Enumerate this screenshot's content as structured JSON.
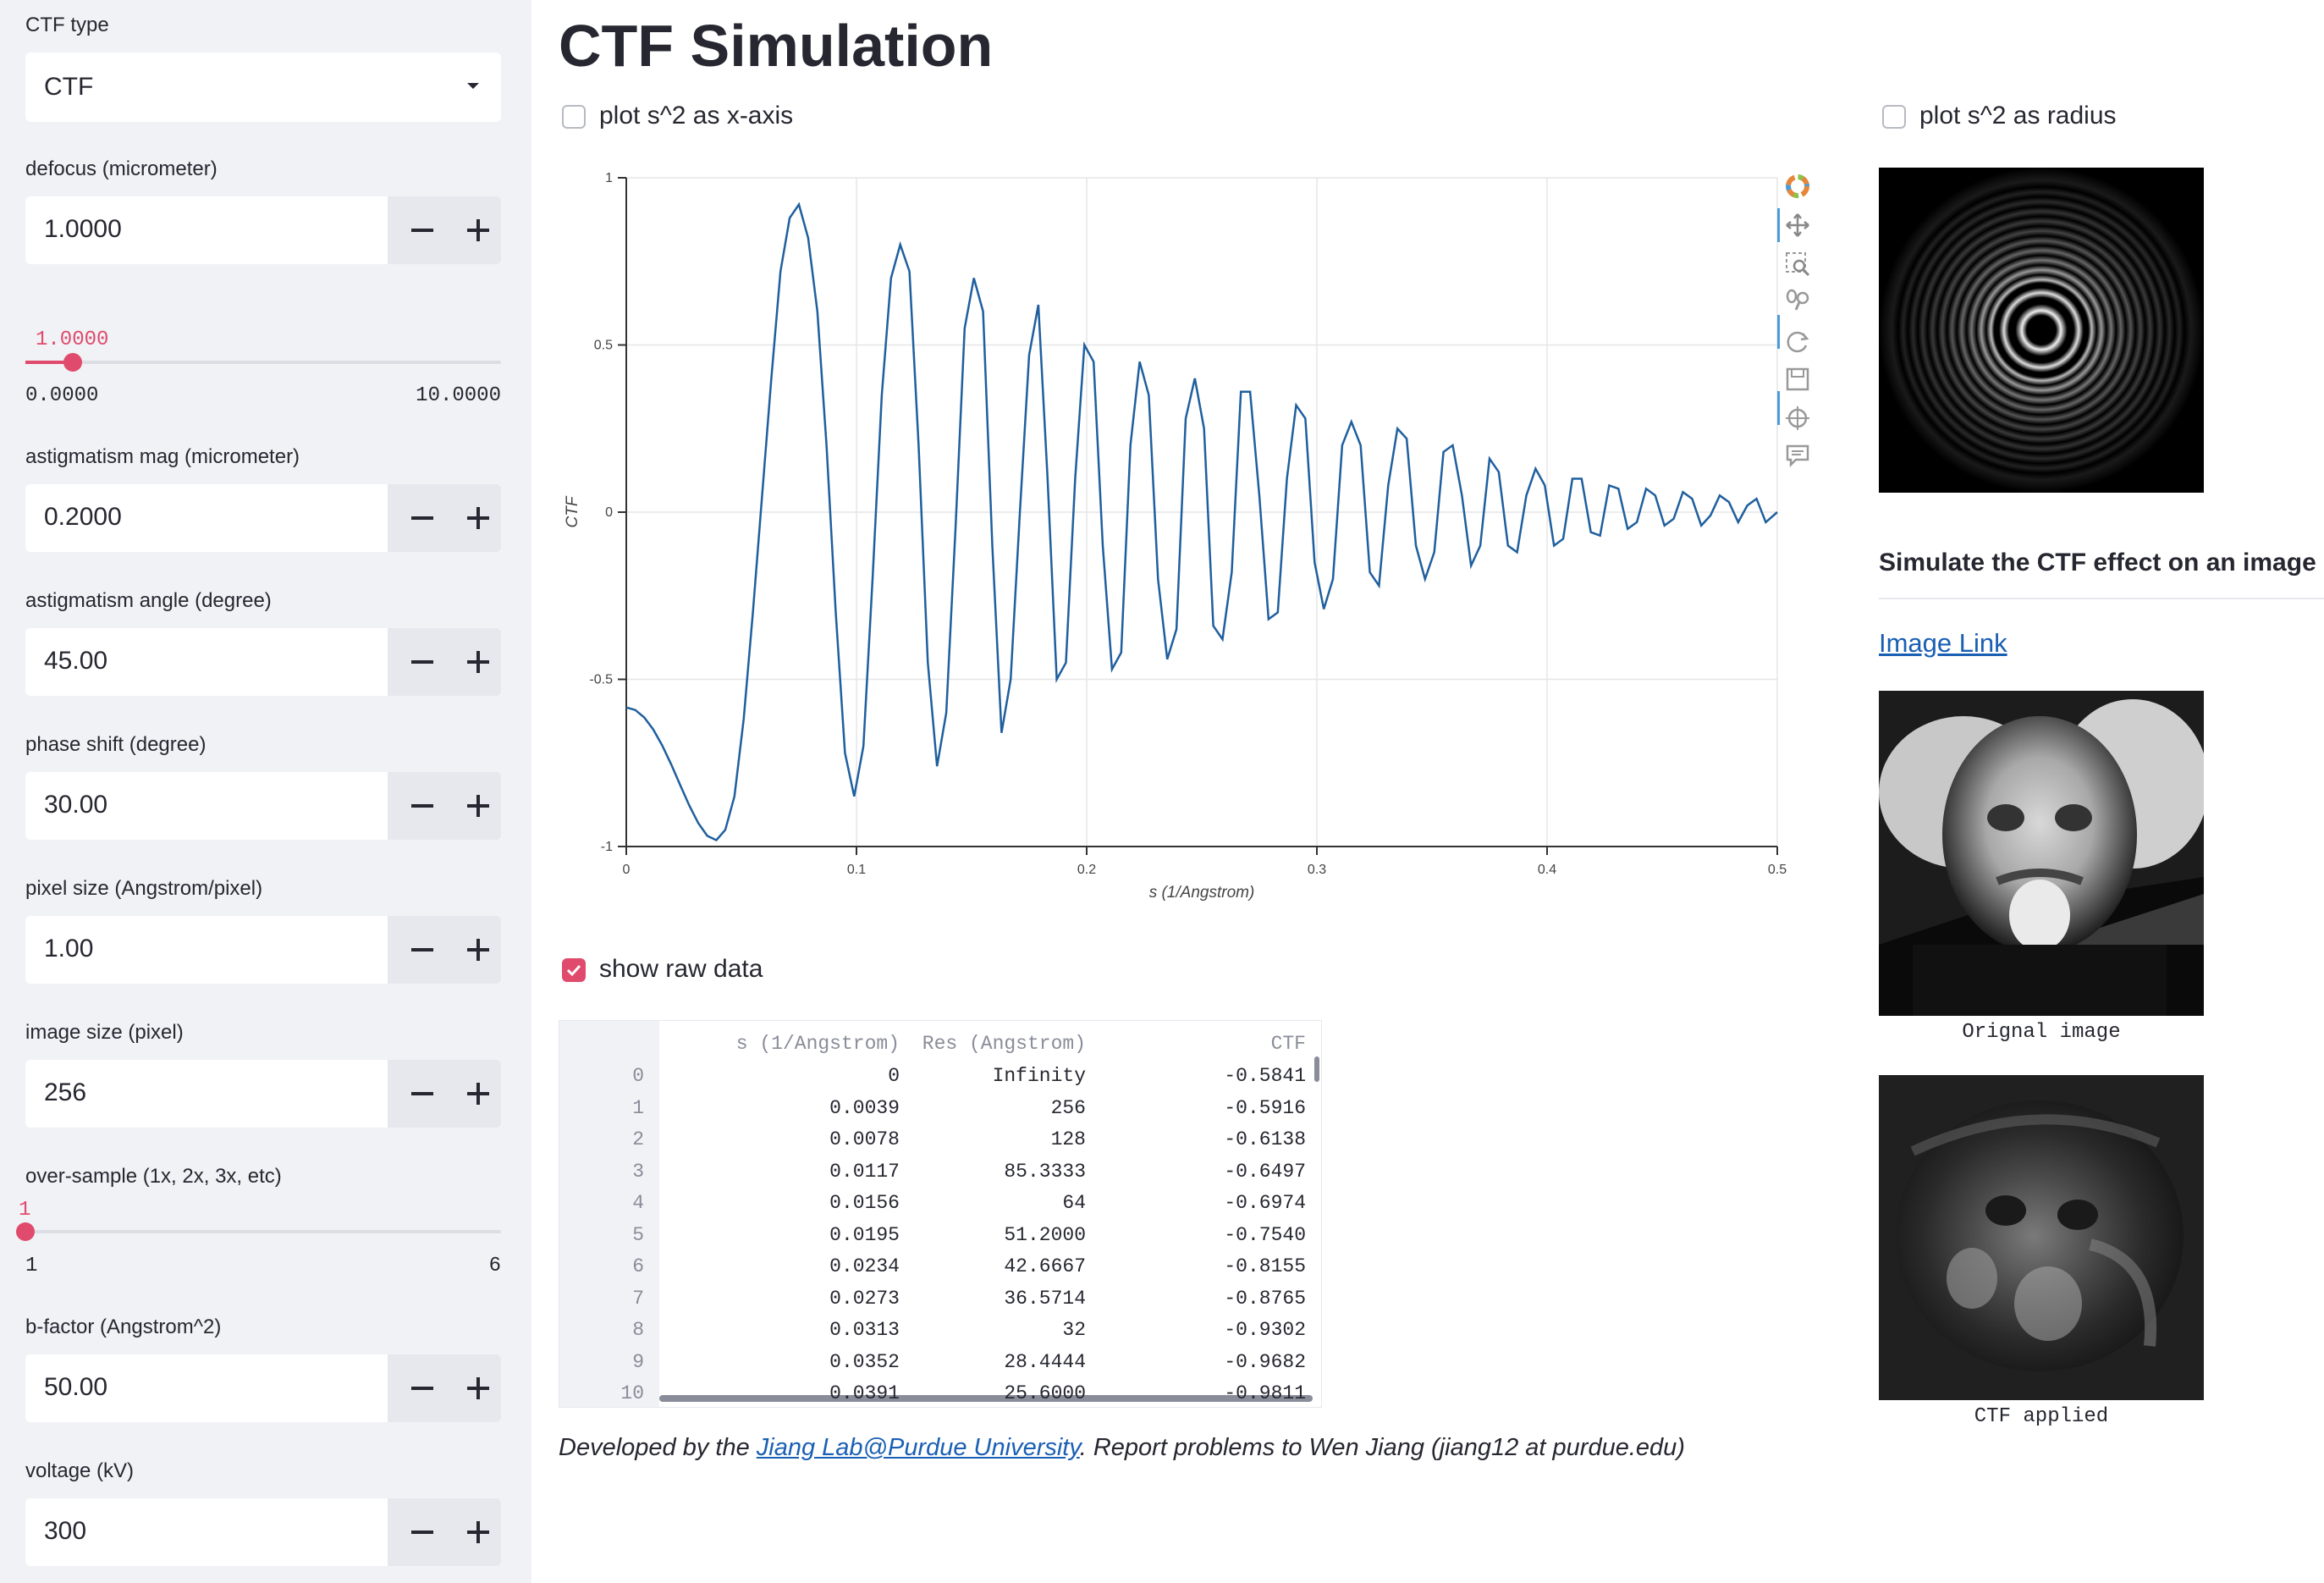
{
  "sidebar": {
    "ctf_type": {
      "label": "CTF type",
      "value": "CTF"
    },
    "defocus": {
      "label": "defocus (micrometer)",
      "value": "1.0000",
      "slider_value": "1.0000",
      "slider_min": "0.0000",
      "slider_max": "10.0000",
      "slider_fraction": 0.1
    },
    "astig_mag": {
      "label": "astigmatism mag (micrometer)",
      "value": "0.2000"
    },
    "astig_angle": {
      "label": "astigmatism angle (degree)",
      "value": "45.00"
    },
    "phase_shift": {
      "label": "phase shift (degree)",
      "value": "30.00"
    },
    "pixel_size": {
      "label": "pixel size (Angstrom/pixel)",
      "value": "1.00"
    },
    "image_size": {
      "label": "image size (pixel)",
      "value": "256"
    },
    "oversample": {
      "label": "over-sample (1x, 2x, 3x, etc)",
      "slider_value": "1",
      "slider_min": "1",
      "slider_max": "6",
      "slider_fraction": 0
    },
    "bfactor": {
      "label": "b-factor (Angstrom^2)",
      "value": "50.00"
    },
    "voltage": {
      "label": "voltage (kV)",
      "value": "300"
    }
  },
  "main": {
    "title": "CTF Simulation",
    "plot_s2_xaxis": {
      "label": "plot s^2 as x-axis",
      "checked": false
    },
    "show_raw": {
      "label": "show raw data",
      "checked": true
    },
    "footer": {
      "prefix": "Developed by the ",
      "link": "Jiang Lab@Purdue University",
      "suffix": ". Report problems to Wen Jiang (jiang12 at purdue.edu)"
    }
  },
  "chart_data": {
    "type": "line",
    "xlabel": "s (1/Angstrom)",
    "ylabel": "CTF",
    "xlim": [
      0,
      0.5
    ],
    "ylim": [
      -1,
      1
    ],
    "xticks": [
      "0",
      "0.1",
      "0.2",
      "0.3",
      "0.4",
      "0.5"
    ],
    "yticks": [
      "1",
      "0.5",
      "0",
      "-0.5",
      "-1"
    ],
    "grid": true,
    "color": "#1f5f9e",
    "series": [
      {
        "x": [
          0,
          0.0039,
          0.0078,
          0.0117,
          0.0156,
          0.0195,
          0.0234,
          0.0273,
          0.0313,
          0.0352,
          0.0391,
          0.043,
          0.047,
          0.051,
          0.055,
          0.059,
          0.063,
          0.067,
          0.071,
          0.075,
          0.079,
          0.083,
          0.087,
          0.091,
          0.095,
          0.099,
          0.103,
          0.107,
          0.111,
          0.115,
          0.119,
          0.123,
          0.127,
          0.131,
          0.135,
          0.139,
          0.143,
          0.147,
          0.151,
          0.155,
          0.159,
          0.163,
          0.167,
          0.171,
          0.175,
          0.179,
          0.183,
          0.187,
          0.191,
          0.195,
          0.199,
          0.203,
          0.207,
          0.211,
          0.215,
          0.219,
          0.223,
          0.227,
          0.231,
          0.235,
          0.239,
          0.243,
          0.247,
          0.251,
          0.255,
          0.259,
          0.263,
          0.267,
          0.271,
          0.275,
          0.279,
          0.283,
          0.287,
          0.291,
          0.295,
          0.299,
          0.303,
          0.307,
          0.311,
          0.315,
          0.319,
          0.323,
          0.327,
          0.331,
          0.335,
          0.339,
          0.343,
          0.347,
          0.351,
          0.355,
          0.359,
          0.363,
          0.367,
          0.371,
          0.375,
          0.379,
          0.383,
          0.387,
          0.391,
          0.395,
          0.399,
          0.403,
          0.407,
          0.411,
          0.415,
          0.419,
          0.423,
          0.427,
          0.431,
          0.435,
          0.439,
          0.443,
          0.447,
          0.451,
          0.455,
          0.459,
          0.463,
          0.467,
          0.471,
          0.475,
          0.479,
          0.483,
          0.487,
          0.491,
          0.495,
          0.5
        ],
        "y": [
          -0.5841,
          -0.5916,
          -0.6138,
          -0.6497,
          -0.6974,
          -0.754,
          -0.8155,
          -0.8765,
          -0.9302,
          -0.9682,
          -0.9811,
          -0.95,
          -0.85,
          -0.62,
          -0.3,
          0.05,
          0.4,
          0.72,
          0.88,
          0.92,
          0.82,
          0.6,
          0.2,
          -0.3,
          -0.72,
          -0.85,
          -0.7,
          -0.2,
          0.35,
          0.7,
          0.8,
          0.72,
          0.2,
          -0.45,
          -0.76,
          -0.6,
          -0.05,
          0.55,
          0.7,
          0.6,
          -0.1,
          -0.66,
          -0.5,
          0.0,
          0.47,
          0.62,
          0.1,
          -0.5,
          -0.45,
          0.1,
          0.5,
          0.45,
          -0.1,
          -0.47,
          -0.42,
          0.2,
          0.45,
          0.35,
          -0.2,
          -0.44,
          -0.35,
          0.28,
          0.4,
          0.25,
          -0.34,
          -0.38,
          -0.18,
          0.36,
          0.36,
          0.05,
          -0.32,
          -0.3,
          0.1,
          0.32,
          0.28,
          -0.15,
          -0.29,
          -0.2,
          0.2,
          0.27,
          0.2,
          -0.18,
          -0.22,
          0.08,
          0.25,
          0.22,
          -0.1,
          -0.2,
          -0.12,
          0.18,
          0.2,
          0.05,
          -0.16,
          -0.1,
          0.16,
          0.12,
          -0.1,
          -0.12,
          0.05,
          0.13,
          0.08,
          -0.1,
          -0.08,
          0.1,
          0.1,
          -0.06,
          -0.07,
          0.08,
          0.07,
          -0.05,
          -0.03,
          0.07,
          0.05,
          -0.04,
          -0.02,
          0.06,
          0.04,
          -0.04,
          -0.01,
          0.05,
          0.03,
          -0.03,
          0.02,
          0.04,
          -0.03,
          0.0
        ]
      }
    ]
  },
  "table": {
    "headers": [
      "s (1/Angstrom)",
      "Res (Angstrom)",
      "CTF"
    ],
    "rows": [
      [
        "0",
        "0",
        "Infinity",
        "-0.5841"
      ],
      [
        "1",
        "0.0039",
        "256",
        "-0.5916"
      ],
      [
        "2",
        "0.0078",
        "128",
        "-0.6138"
      ],
      [
        "3",
        "0.0117",
        "85.3333",
        "-0.6497"
      ],
      [
        "4",
        "0.0156",
        "64",
        "-0.6974"
      ],
      [
        "5",
        "0.0195",
        "51.2000",
        "-0.7540"
      ],
      [
        "6",
        "0.0234",
        "42.6667",
        "-0.8155"
      ],
      [
        "7",
        "0.0273",
        "36.5714",
        "-0.8765"
      ],
      [
        "8",
        "0.0313",
        "32",
        "-0.9302"
      ],
      [
        "9",
        "0.0352",
        "28.4444",
        "-0.9682"
      ],
      [
        "10",
        "0.0391",
        "25.6000",
        "-0.9811"
      ]
    ]
  },
  "right": {
    "plot_s2_radius": {
      "label": "plot s^2 as radius",
      "checked": false
    },
    "subheader": "Simulate the CTF effect on an image",
    "link": "Image Link",
    "orig_caption": "Orignal image",
    "ctf_caption": "CTF applied"
  },
  "icons": [
    "bokeh-logo-icon",
    "pan-icon",
    "box-zoom-icon",
    "wheel-zoom-icon",
    "reset-icon",
    "save-icon",
    "crosshair-icon",
    "hover-icon"
  ]
}
